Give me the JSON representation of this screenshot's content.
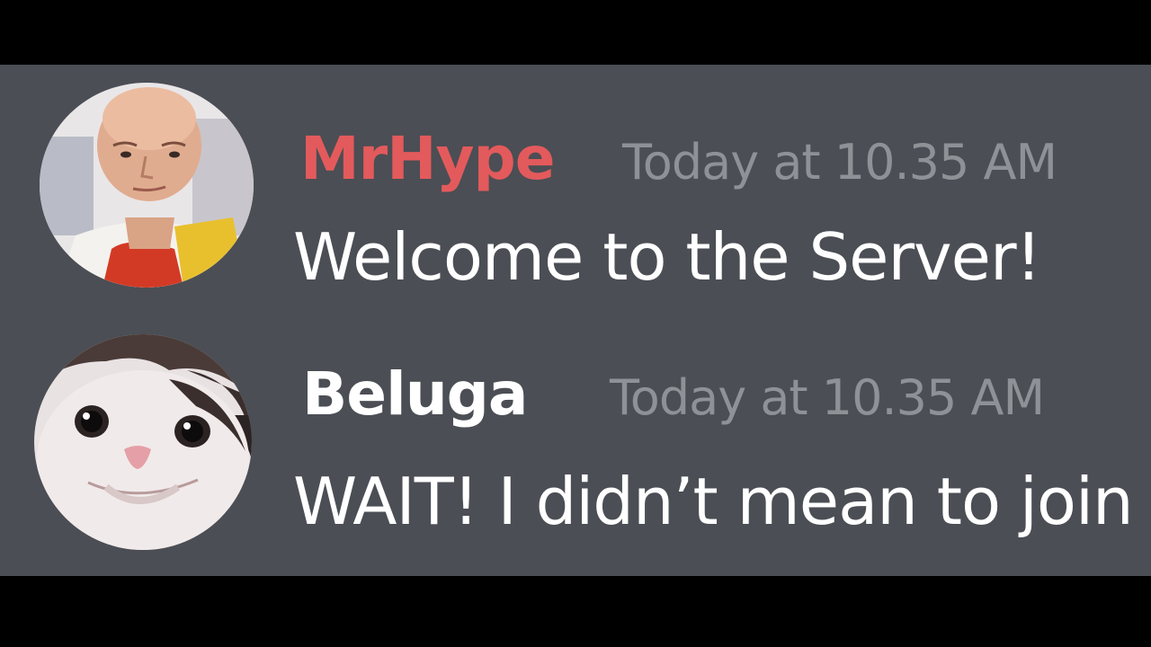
{
  "colors": {
    "background": "#000000",
    "panel": "#4b4e54",
    "timestamp": "#8e9297",
    "message_text": "#ffffff"
  },
  "messages": [
    {
      "username": "MrHype",
      "username_color": "#e35a5c",
      "timestamp": "Today at 10.35 AM",
      "text": "Welcome to the Server!",
      "avatar_icon": "bald-man-avatar"
    },
    {
      "username": "Beluga",
      "username_color": "#ffffff",
      "timestamp": "Today at 10.35 AM",
      "text": "WAIT! I didn’t mean to join",
      "avatar_icon": "cat-avatar"
    }
  ]
}
